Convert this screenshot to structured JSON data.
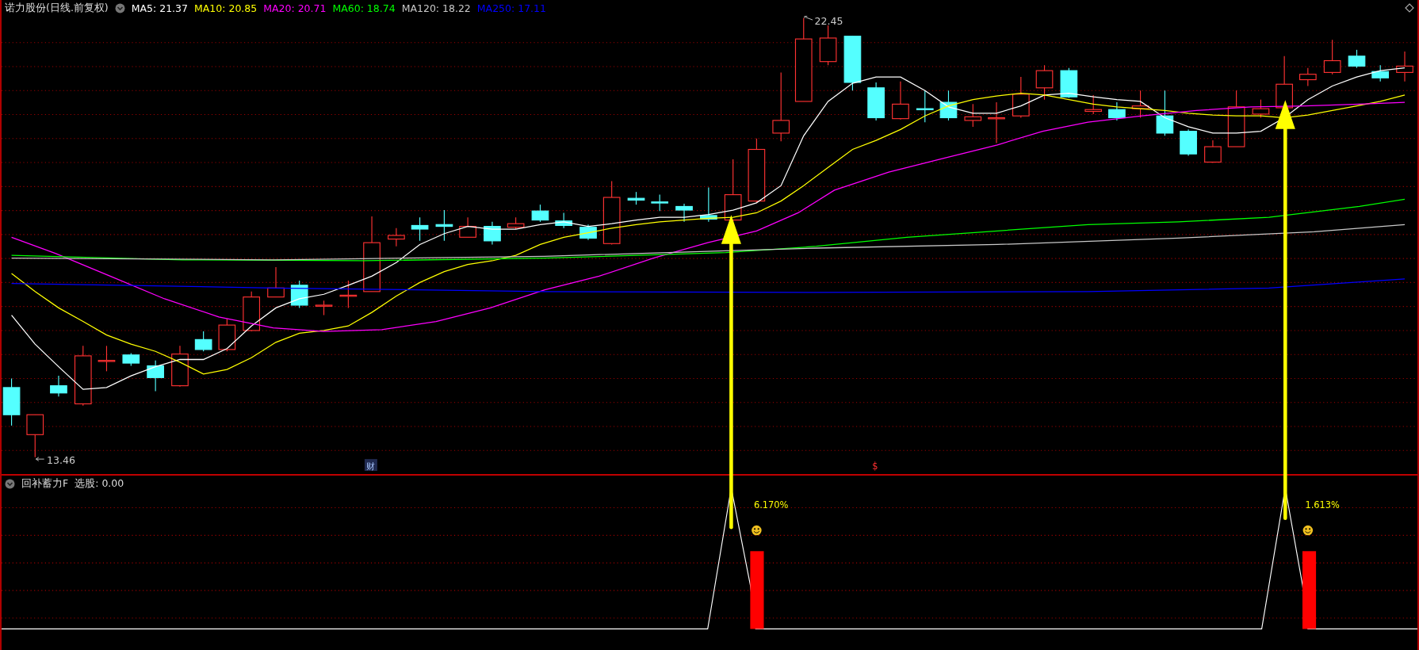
{
  "chart": {
    "title": "诺力股份(日线.前复权)",
    "moving_averages": [
      {
        "label": "MA5: 21.37",
        "color": "#ffffff"
      },
      {
        "label": "MA10: 20.85",
        "color": "#ffff00"
      },
      {
        "label": "MA20: 20.71",
        "color": "#ff00ff"
      },
      {
        "label": "MA60: 18.74",
        "color": "#00ff00"
      },
      {
        "label": "MA120: 18.22",
        "color": "#c8c8c8"
      },
      {
        "label": "MA250: 17.11",
        "color": "#0000ff"
      }
    ],
    "high_label": "22.45",
    "low_label": "13.46",
    "markers": [
      {
        "kind": "finance",
        "text": "财"
      },
      {
        "kind": "dividend",
        "text": "$"
      }
    ]
  },
  "indicator": {
    "title": "回补蓄力F",
    "reading": "选股: 0.00",
    "signals": [
      {
        "text": "6.170%"
      },
      {
        "text": "1.613%"
      }
    ]
  }
}
